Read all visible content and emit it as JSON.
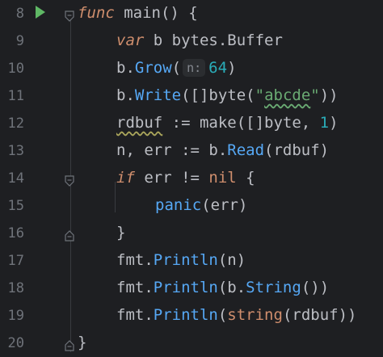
{
  "editor": {
    "lines": [
      {
        "num": "8",
        "tokens": [
          {
            "t": "func",
            "c": "kw"
          },
          {
            "t": " main() {",
            "c": ""
          }
        ]
      },
      {
        "num": "9",
        "tokens": [
          {
            "t": "var",
            "c": "kw"
          },
          {
            "t": " b bytes.Buffer",
            "c": ""
          }
        ]
      },
      {
        "num": "10",
        "tokens": [
          {
            "t": "b.",
            "c": ""
          },
          {
            "t": "Grow",
            "c": "fn"
          },
          {
            "t": "(",
            "c": ""
          },
          {
            "t": "n:",
            "c": "hint"
          },
          {
            "t": "64",
            "c": "num"
          },
          {
            "t": ")",
            "c": ""
          }
        ]
      },
      {
        "num": "11",
        "tokens": [
          {
            "t": "b.",
            "c": ""
          },
          {
            "t": "Write",
            "c": "fn"
          },
          {
            "t": "([]byte(",
            "c": ""
          },
          {
            "t": "\"",
            "c": "str"
          },
          {
            "t": "abcde",
            "c": "str squiggle"
          },
          {
            "t": "\"",
            "c": "str"
          },
          {
            "t": "))",
            "c": ""
          }
        ]
      },
      {
        "num": "12",
        "tokens": [
          {
            "t": "rdbuf",
            "c": "warn"
          },
          {
            "t": " := make([]byte, ",
            "c": ""
          },
          {
            "t": "1",
            "c": "num"
          },
          {
            "t": ")",
            "c": ""
          }
        ]
      },
      {
        "num": "13",
        "tokens": [
          {
            "t": "n, err := b.",
            "c": ""
          },
          {
            "t": "Read",
            "c": "fn"
          },
          {
            "t": "(rdbuf)",
            "c": ""
          }
        ]
      },
      {
        "num": "14",
        "tokens": [
          {
            "t": "if",
            "c": "kw"
          },
          {
            "t": " err != ",
            "c": ""
          },
          {
            "t": "nil",
            "c": "kw2"
          },
          {
            "t": " {",
            "c": ""
          }
        ]
      },
      {
        "num": "15",
        "tokens": [
          {
            "t": "panic",
            "c": "fn"
          },
          {
            "t": "(err)",
            "c": ""
          }
        ]
      },
      {
        "num": "16",
        "tokens": [
          {
            "t": "}",
            "c": ""
          }
        ]
      },
      {
        "num": "17",
        "tokens": [
          {
            "t": "fmt.",
            "c": ""
          },
          {
            "t": "Println",
            "c": "fn"
          },
          {
            "t": "(n)",
            "c": ""
          }
        ]
      },
      {
        "num": "18",
        "tokens": [
          {
            "t": "fmt.",
            "c": ""
          },
          {
            "t": "Println",
            "c": "fn"
          },
          {
            "t": "(b.",
            "c": ""
          },
          {
            "t": "String",
            "c": "fn"
          },
          {
            "t": "())",
            "c": ""
          }
        ]
      },
      {
        "num": "19",
        "tokens": [
          {
            "t": "fmt.",
            "c": ""
          },
          {
            "t": "Println",
            "c": "fn"
          },
          {
            "t": "(",
            "c": ""
          },
          {
            "t": "string",
            "c": "kw2"
          },
          {
            "t": "(rdbuf))",
            "c": ""
          }
        ]
      },
      {
        "num": "20",
        "tokens": [
          {
            "t": "}",
            "c": ""
          }
        ]
      }
    ],
    "indents": [
      0,
      1,
      1,
      1,
      1,
      1,
      1,
      2,
      1,
      1,
      1,
      1,
      0
    ],
    "icons": {
      "run": "run-gutter-icon",
      "fold": "fold-marker-icon"
    },
    "colors": {
      "background": "#1e1f22",
      "keyword": "#cf8e6d",
      "function": "#56a8f5",
      "string": "#6aab73",
      "number": "#2aacb8"
    }
  }
}
